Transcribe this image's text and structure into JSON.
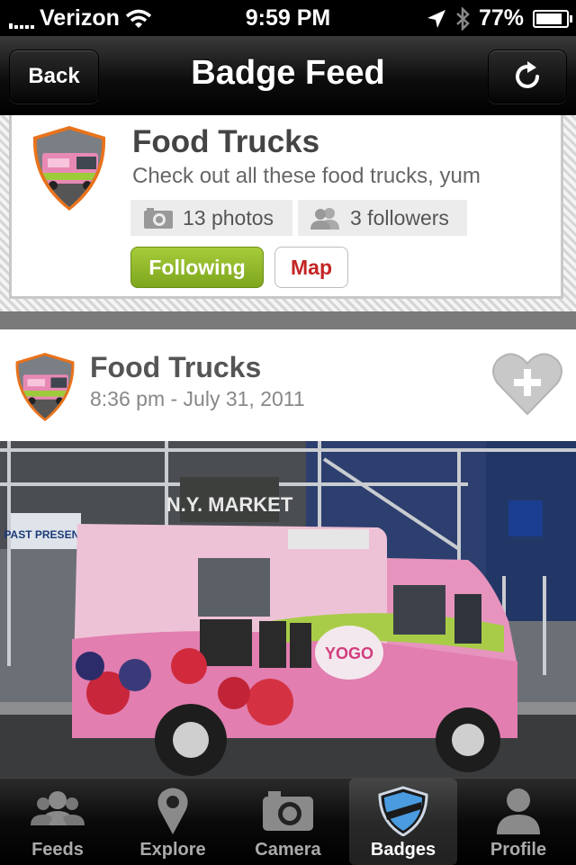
{
  "status_bar": {
    "carrier": "Verizon",
    "time": "9:59 PM",
    "battery": "77%",
    "battery_level": 0.77
  },
  "nav": {
    "title": "Badge Feed",
    "back_label": "Back",
    "refresh_icon": "refresh-icon"
  },
  "badge": {
    "title": "Food Trucks",
    "description": "Check out all these food trucks, yum",
    "photos": "13 photos",
    "followers": "3 followers",
    "following_label": "Following",
    "map_label": "Map",
    "colors": {
      "following": "#8db52a",
      "map_text": "#c42424",
      "shield_border": "#e8731c"
    }
  },
  "post": {
    "badge_title": "Food Trucks",
    "timestamp": "8:36 pm - July 31, 2011",
    "photo_sign_market": "N.Y. MARKET",
    "photo_sign_left": "PAST PRESENT",
    "truck_text": "YOGO"
  },
  "tabs": [
    {
      "label": "Feeds",
      "icon": "people-icon",
      "active": false
    },
    {
      "label": "Explore",
      "icon": "map-pin-icon",
      "active": false
    },
    {
      "label": "Camera",
      "icon": "camera-icon",
      "active": false
    },
    {
      "label": "Badges",
      "icon": "badge-shield-icon",
      "active": true
    },
    {
      "label": "Profile",
      "icon": "person-icon",
      "active": false
    }
  ]
}
